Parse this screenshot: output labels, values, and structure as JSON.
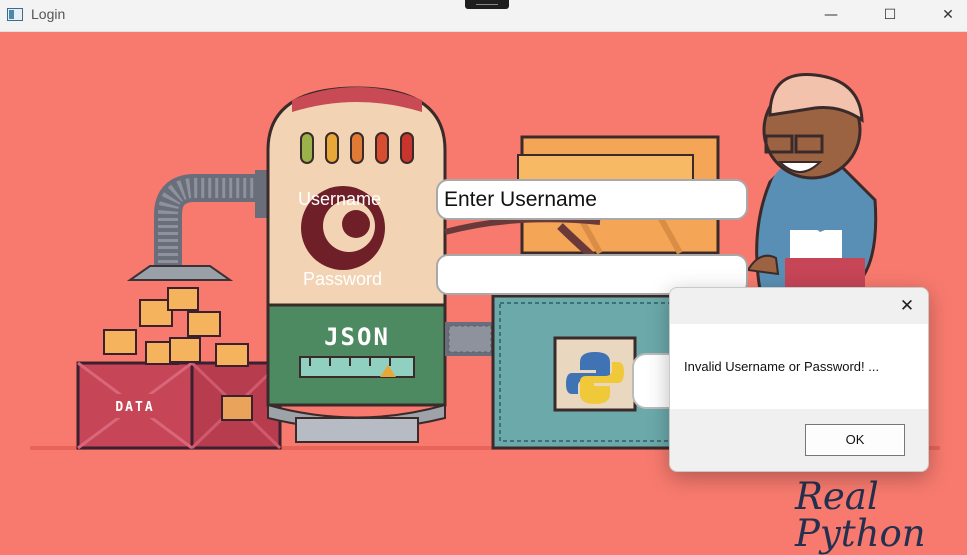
{
  "window": {
    "title": "Login",
    "controls": {
      "minimize": "—",
      "maximize": "☐",
      "close": "✕"
    }
  },
  "login": {
    "username_label": "Username",
    "username_value": "Enter Username",
    "password_label": "Password",
    "password_value": ""
  },
  "illustration": {
    "json_text": "JSON",
    "data_text": "DATA",
    "brand": "Real Python"
  },
  "dialog": {
    "close": "✕",
    "message": "Invalid Username or Password! ...",
    "ok_label": "OK"
  },
  "colors": {
    "background": "#f87a6e",
    "tank_top": "#f2d3b4",
    "tank_bottom": "#4e8a61",
    "crate_red": "#c64557",
    "wallet_teal": "#6ba9ab",
    "brand_navy": "#23304f"
  },
  "icons": [
    "app-icon",
    "python-logo-icon",
    "folder-icon",
    "close-icon"
  ]
}
